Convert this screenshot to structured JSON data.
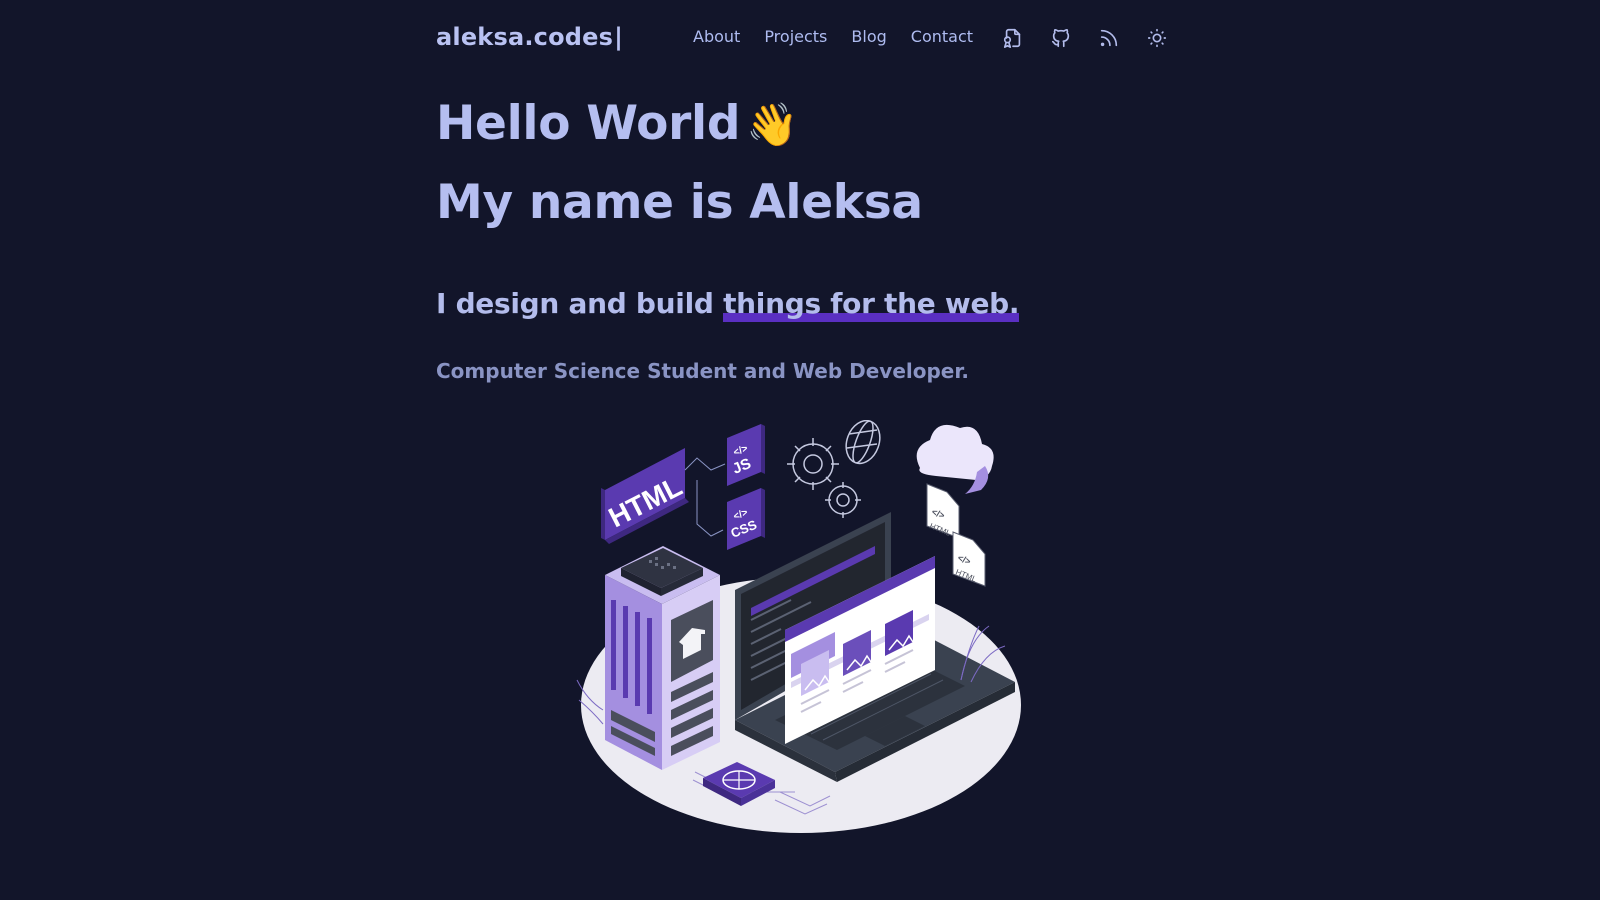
{
  "header": {
    "logo": "aleksa.codes",
    "logo_cursor": "|",
    "nav": [
      {
        "label": "About"
      },
      {
        "label": "Projects"
      },
      {
        "label": "Blog"
      },
      {
        "label": "Contact"
      }
    ],
    "icons": [
      "resume-icon",
      "github-icon",
      "rss-icon",
      "sun-icon"
    ]
  },
  "hero": {
    "greeting": "Hello World",
    "greeting_emoji": "👋",
    "name_line": "My name is Aleksa",
    "tagline_start": "I design and build ",
    "tagline_highlight": "things for the web.",
    "subtitle": "Computer Science Student and Web Developer."
  },
  "illustration": {
    "labels": {
      "html_block": "HTML",
      "js_tile": "JS",
      "css_tile": "CSS",
      "code_glyph": "</>",
      "doc1": "HTML",
      "doc2": "HTML"
    }
  },
  "colors": {
    "background": "#12152a",
    "text": "#b5bef0",
    "muted": "#8a94c4",
    "accent": "#5a2fc2",
    "purple": "#6b4fbb",
    "light_purple": "#a590dc"
  }
}
